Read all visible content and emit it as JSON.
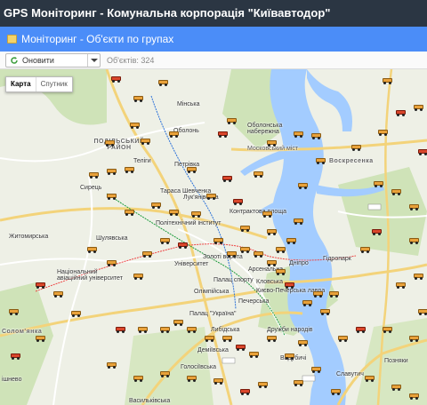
{
  "app": {
    "title": "GPS Моніторинг - Комунальна корпорація \"Київавтодор\""
  },
  "panel": {
    "title": "Моніторинг - Об'єкти по групах",
    "icon": "folder-icon"
  },
  "toolbar": {
    "refresh_label": "Оновити",
    "objects_count": "Об'єктів: 324"
  },
  "map": {
    "type_control": {
      "map_label": "Карта",
      "satellite_label": "Спутник",
      "active": "Карта"
    },
    "labels": {
      "minska": "Мінська",
      "obolon": "Оболонь",
      "obolonska_naberezhna": "Оболонська набережна",
      "podilskyi": "ПОДІЛЬСЬКИЙ РАЙОН",
      "petrivka": "Петрівка",
      "moskovskyi_mist": "Московський міст",
      "syrets": "Сирець",
      "taras_shevchenka": "Тараса Шевченка",
      "kontraktova": "Контрактова площа",
      "lukianivska": "Лук'янівська",
      "zhytomyrska": "Житомирська",
      "shuliavska": "Шулявська",
      "politekhnichnyi": "Політехнічний інститут",
      "zoloti_vorota": "Золоті ворота",
      "universytet": "Університет",
      "arsenalna": "Арсенальна",
      "dnipro": "Дніпро",
      "hidropark": "Гідропарк",
      "natsionalnyi_aviatsiinyi": "Національний авіаційний університет",
      "olimpiiska": "Олімпійська",
      "palats_sportu": "Палац спорту",
      "kyievo_pecherska": "Києво-Печерська лавра",
      "klovska": "Кловська",
      "pecherska": "Печерська",
      "ploshcha_ukraina": "Палац \"Україна\"",
      "lybidska": "Либідська",
      "druzhby_narodiv": "Дружби народів",
      "demiivska": "Деміївська",
      "holosiivska": "Голосіївська",
      "vasylkivska": "Васильківська",
      "pozniaky": "Позняки",
      "slavutych": "Славутич",
      "vydubychi": "Видубичі",
      "voskresenka": "Воскресенка",
      "shuliavka_left": "Шулявка",
      "solomianka": "Солом'янка",
      "oshnevo": "ішнево",
      "ulitsa_teliha": "Теліги"
    }
  },
  "colors": {
    "header_bg": "#2b3643",
    "panel_bg": "#4b8df8",
    "water": "#a3ccff",
    "vehicle": "#e8a13a"
  }
}
